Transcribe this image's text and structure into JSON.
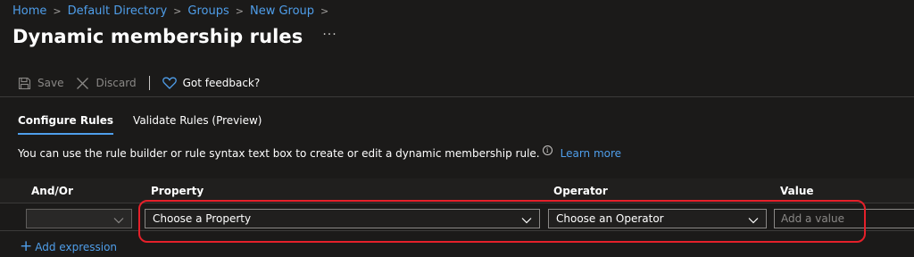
{
  "breadcrumb": {
    "items": [
      "Home",
      "Default Directory",
      "Groups",
      "New Group"
    ],
    "separator": ">"
  },
  "header": {
    "title": "Dynamic membership rules",
    "more": "···"
  },
  "toolbar": {
    "save_label": "Save",
    "discard_label": "Discard",
    "feedback_label": "Got feedback?"
  },
  "tabs": [
    {
      "label": "Configure Rules",
      "active": true
    },
    {
      "label": "Validate Rules (Preview)",
      "active": false
    }
  ],
  "info": {
    "text": "You can use the rule builder or rule syntax text box to create or edit a dynamic membership rule.",
    "icon_glyph": "i",
    "link": "Learn more"
  },
  "rule_table": {
    "columns": [
      "And/Or",
      "Property",
      "Operator",
      "Value"
    ],
    "row": {
      "andor": "",
      "property": "Choose a Property",
      "operator": "Choose an Operator",
      "value_placeholder": "Add a value"
    }
  },
  "add_expression": {
    "plus": "+",
    "label": "Add expression"
  },
  "colors": {
    "background": "#1b1a19",
    "link": "#4f9eea",
    "highlight": "#e5202a"
  }
}
